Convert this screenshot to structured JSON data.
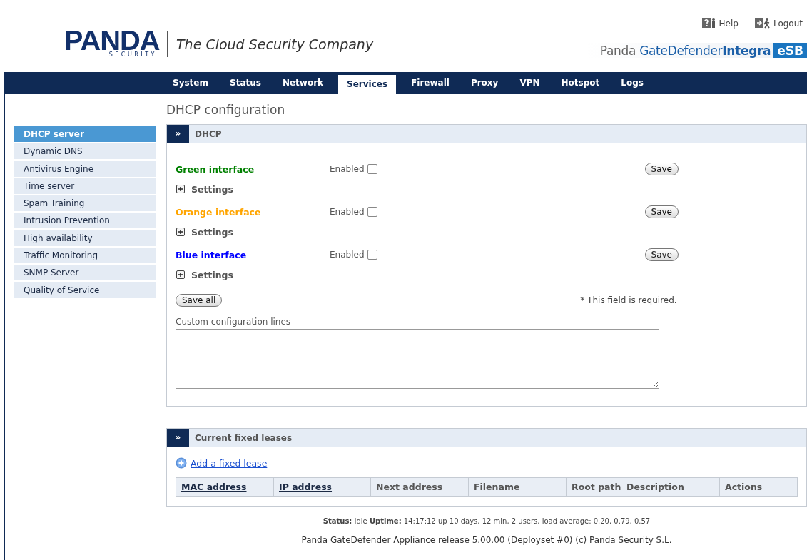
{
  "top_links": [
    {
      "label": "Help",
      "kind": "help"
    },
    {
      "label": "Logout",
      "kind": "logout"
    }
  ],
  "logo": {
    "name": "PANDA",
    "sub": "SECURITY",
    "tagline": "The Cloud Security Company"
  },
  "product": {
    "prefix": "Panda",
    "name": "GateDefender",
    "edition": "Integra",
    "badge": "eSB"
  },
  "nav": [
    {
      "label": "System",
      "selected": false
    },
    {
      "label": "Status",
      "selected": false
    },
    {
      "label": "Network",
      "selected": false
    },
    {
      "label": "Services",
      "selected": true
    },
    {
      "label": "Firewall",
      "selected": false
    },
    {
      "label": "Proxy",
      "selected": false
    },
    {
      "label": "VPN",
      "selected": false
    },
    {
      "label": "Hotspot",
      "selected": false
    },
    {
      "label": "Logs",
      "selected": false
    }
  ],
  "page_title": "DHCP configuration",
  "sidebar": [
    {
      "label": "DHCP server",
      "selected": true
    },
    {
      "label": "Dynamic DNS",
      "selected": false
    },
    {
      "label": "Antivirus Engine",
      "selected": false
    },
    {
      "label": "Time server",
      "selected": false
    },
    {
      "label": "Spam Training",
      "selected": false
    },
    {
      "label": "Intrusion Prevention",
      "selected": false
    },
    {
      "label": "High availability",
      "selected": false
    },
    {
      "label": "Traffic Monitoring",
      "selected": false
    },
    {
      "label": "SNMP Server",
      "selected": false
    },
    {
      "label": "Quality of Service",
      "selected": false
    }
  ],
  "dhcp_panel": {
    "toggle": "»",
    "title": "DHCP",
    "interfaces": [
      {
        "name": "Green interface",
        "color": "#008000",
        "enabled_label": "Enabled",
        "checked": false,
        "settings": "Settings",
        "save": "Save"
      },
      {
        "name": "Orange interface",
        "color": "#ffa500",
        "enabled_label": "Enabled",
        "checked": false,
        "settings": "Settings",
        "save": "Save"
      },
      {
        "name": "Blue interface",
        "color": "#0000ff",
        "enabled_label": "Enabled",
        "checked": false,
        "settings": "Settings",
        "save": "Save"
      }
    ],
    "save_all": "Save all",
    "required_note": "* This field is required.",
    "custom_label": "Custom configuration lines"
  },
  "leases_panel": {
    "toggle": "»",
    "title": "Current fixed leases",
    "add_link": "Add a fixed lease",
    "columns": [
      {
        "label": "MAC address",
        "sortable": true
      },
      {
        "label": "IP address",
        "sortable": true
      },
      {
        "label": "Next address",
        "sortable": false
      },
      {
        "label": "Filename",
        "sortable": false
      },
      {
        "label": "Root path",
        "sortable": false
      },
      {
        "label": "Description",
        "sortable": false
      },
      {
        "label": "Actions",
        "sortable": false
      }
    ]
  },
  "status_line": "**Status:** Idle **Uptime:** 14:17:12 up 10 days, 12 min, 2 users, load average: 0.20, 0.79, 0.57",
  "footer": "Panda GateDefender Appliance release 5.00.00 (Deployset #0) (c) Panda Security S.L."
}
